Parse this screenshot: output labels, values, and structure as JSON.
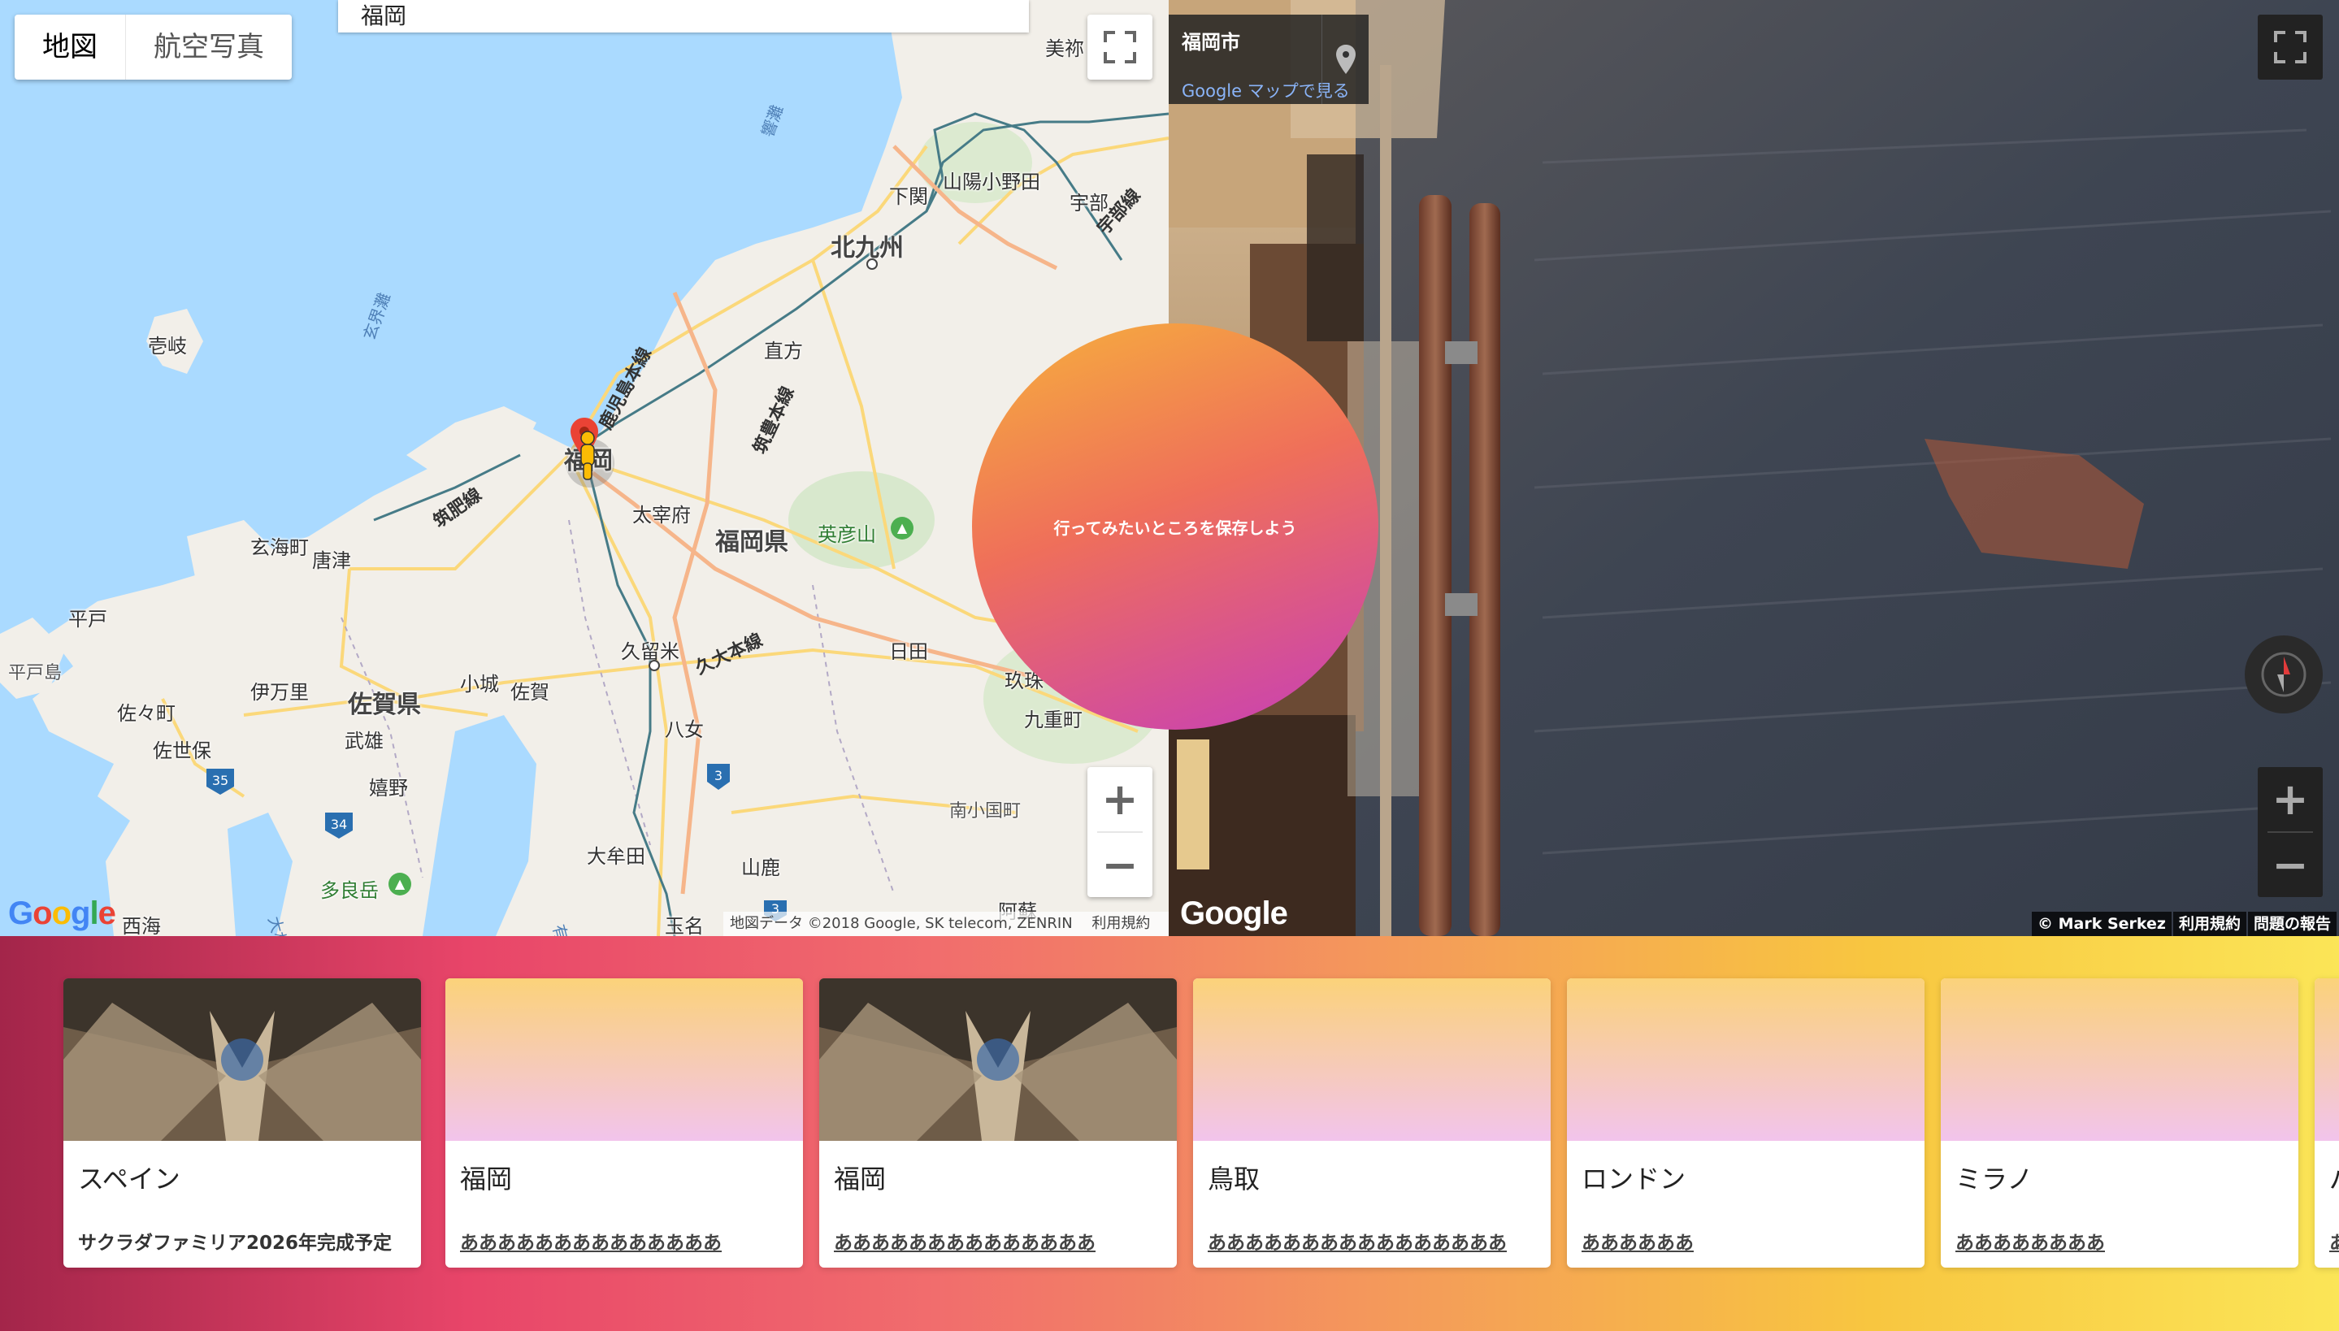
{
  "map": {
    "type_control": {
      "map_label": "地図",
      "satellite_label": "航空写真"
    },
    "search_value": "福岡",
    "labels": {
      "misaki": "美祢",
      "shimonoseki": "下関",
      "sanyo_onoda": "山陽小野田",
      "ube": "宇部",
      "ube_line": "宇部線",
      "kitakyushu": "北九州",
      "iki": "壱岐",
      "genkainada": "玄界灘",
      "hibikinada": "響灘",
      "kagoshima_line": "鹿児島本線",
      "nogata": "直方",
      "chikuho_line": "筑豊本線",
      "fukuoka": "福岡",
      "chikuhi_line": "筑肥線",
      "dazaifu": "太宰府",
      "fukuoka_pref": "福岡県",
      "hikosan": "英彦山",
      "genkai": "玄海町",
      "karatsu": "唐津",
      "hirado": "平戸",
      "hiradoshima": "平戸島",
      "kurume": "久留米",
      "kyudai_line": "久大本線",
      "hita": "日田",
      "tamaru": "玖珠",
      "kokonoe": "九重町",
      "sasebo_town": "佐々町",
      "imari": "伊万里",
      "saga_pref": "佐賀県",
      "ogi": "小城",
      "saga": "佐賀",
      "takeo": "武雄",
      "sasebo": "佐世保",
      "yame": "八女",
      "ureshino": "嬉野",
      "minamioguni": "南小国町",
      "omuta": "大牟田",
      "yamaga": "山鹿",
      "taradake": "多良岳",
      "saikai": "西海",
      "tamana": "玉名",
      "aso": "阿蘇",
      "ariake": "有明海",
      "omura": "大村湾"
    },
    "routes": {
      "r35": "35",
      "r34": "34",
      "r3a": "3",
      "r3b": "3"
    },
    "attribution": "地図データ ©2018 Google, SK telecom, ZENRIN",
    "terms": "利用規約",
    "logo": "Google"
  },
  "streetview": {
    "title": "福岡市",
    "link": "Google マップで見る",
    "logo": "Google",
    "attribution": {
      "author": "© Mark Serkez",
      "terms": "利用規約",
      "report": "問題の報告"
    }
  },
  "save_circle": {
    "text": "行ってみたいところを保存しよう"
  },
  "cards": [
    {
      "title": "スペイン",
      "desc": "サクラダファミリア2026年完成予定",
      "thumb": "photo"
    },
    {
      "title": "福岡",
      "desc": "ああああああああああああああ",
      "thumb": "gradient"
    },
    {
      "title": "福岡",
      "desc": "ああああああああああああああ",
      "thumb": "photo"
    },
    {
      "title": "鳥取",
      "desc": "ああああああああああああああああ",
      "thumb": "gradient"
    },
    {
      "title": "ロンドン",
      "desc": "ああああああ",
      "thumb": "gradient"
    },
    {
      "title": "ミラノ",
      "desc": "ああああああああ",
      "thumb": "gradient"
    },
    {
      "title": "パ",
      "desc": "あ",
      "thumb": "gradient"
    }
  ],
  "colors": {
    "strip_gradient": [
      "#a3254a",
      "#e84569",
      "#f49b5a",
      "#fbe557"
    ],
    "circle_gradient": [
      "#f6b13c",
      "#c63eb9"
    ],
    "card_gradient": [
      "#fbd27a",
      "#f2c4ec"
    ]
  }
}
